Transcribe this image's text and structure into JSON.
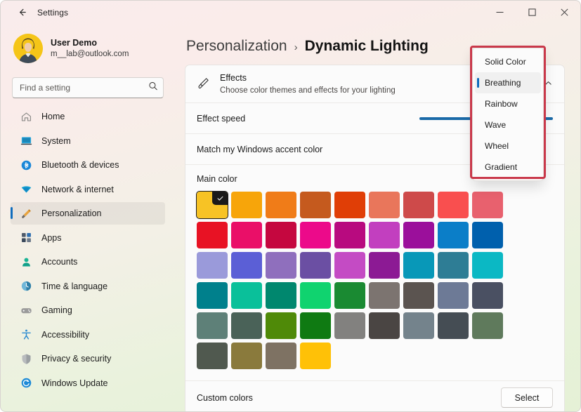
{
  "window": {
    "title": "Settings",
    "back_icon": "back-arrow-icon",
    "minimize_label": "Minimize",
    "maximize_label": "Maximize",
    "close_label": "Close"
  },
  "account": {
    "name": "User Demo",
    "email": "m__lab@outlook.com",
    "avatar_bg": "#f5c518"
  },
  "search": {
    "placeholder": "Find a setting",
    "icon": "search-icon"
  },
  "sidebar": {
    "items": [
      {
        "label": "Home",
        "icon": "home-icon",
        "active": false
      },
      {
        "label": "System",
        "icon": "system-icon",
        "active": false
      },
      {
        "label": "Bluetooth & devices",
        "icon": "bluetooth-icon",
        "active": false
      },
      {
        "label": "Network & internet",
        "icon": "network-icon",
        "active": false
      },
      {
        "label": "Personalization",
        "icon": "brush-icon",
        "active": true
      },
      {
        "label": "Apps",
        "icon": "apps-icon",
        "active": false
      },
      {
        "label": "Accounts",
        "icon": "account-icon",
        "active": false
      },
      {
        "label": "Time & language",
        "icon": "clock-icon",
        "active": false
      },
      {
        "label": "Gaming",
        "icon": "gamepad-icon",
        "active": false
      },
      {
        "label": "Accessibility",
        "icon": "accessibility-icon",
        "active": false
      },
      {
        "label": "Privacy & security",
        "icon": "shield-icon",
        "active": false
      },
      {
        "label": "Windows Update",
        "icon": "update-icon",
        "active": false
      }
    ]
  },
  "breadcrumb": {
    "parent": "Personalization",
    "separator": "›",
    "current": "Dynamic Lighting"
  },
  "settings": {
    "effects": {
      "icon": "brush-icon",
      "title": "Effects",
      "subtitle": "Choose color themes and effects for your lighting",
      "expand_icon": "chevron-up-icon"
    },
    "effect_speed": {
      "label": "Effect speed",
      "value_percent": 100,
      "accent": "#1a6aa8"
    },
    "match_accent": {
      "label": "Match my Windows accent color"
    },
    "main_color": {
      "label": "Main color",
      "selected_index": 0,
      "check_icon": "checkmark-icon",
      "swatches": [
        "#f7c325",
        "#f7a50a",
        "#f07c18",
        "#c55a1e",
        "#e03e06",
        "#e9765b",
        "#ce4a4a",
        "#f94f4f",
        "#e8616e",
        "#e81224",
        "#ea0f68",
        "#c5073f",
        "#ec0a8a",
        "#b80a7f",
        "#c23fbf",
        "#9b0f9b",
        "#0b7ec8",
        "#0060ad",
        "#9a9ada",
        "#5b5fd6",
        "#8f6fbd",
        "#6b4fa3",
        "#c44bc4",
        "#8c1a94",
        "#0898b8",
        "#2e7d95",
        "#0bb8c4",
        "#00808c",
        "#0ac09a",
        "#00876e",
        "#10d36f",
        "#1a8a32",
        "#7c7470",
        "#5b5450",
        "#6d7a96",
        "#4a5062",
        "#5e8078",
        "#4a6258",
        "#4f8a08",
        "#0f7a12",
        "#82817f",
        "#4a4543",
        "#74838c",
        "#454d54",
        "#5f7a5c",
        "#50594f",
        "#8a7a3c",
        "#7e7263",
        "#ffc107"
      ]
    },
    "custom_colors": {
      "label": "Custom colors",
      "button_label": "Select"
    }
  },
  "dropdown": {
    "highlight_color": "#c9384a",
    "selected": "Breathing",
    "items": [
      "Solid Color",
      "Breathing",
      "Rainbow",
      "Wave",
      "Wheel",
      "Gradient"
    ]
  }
}
